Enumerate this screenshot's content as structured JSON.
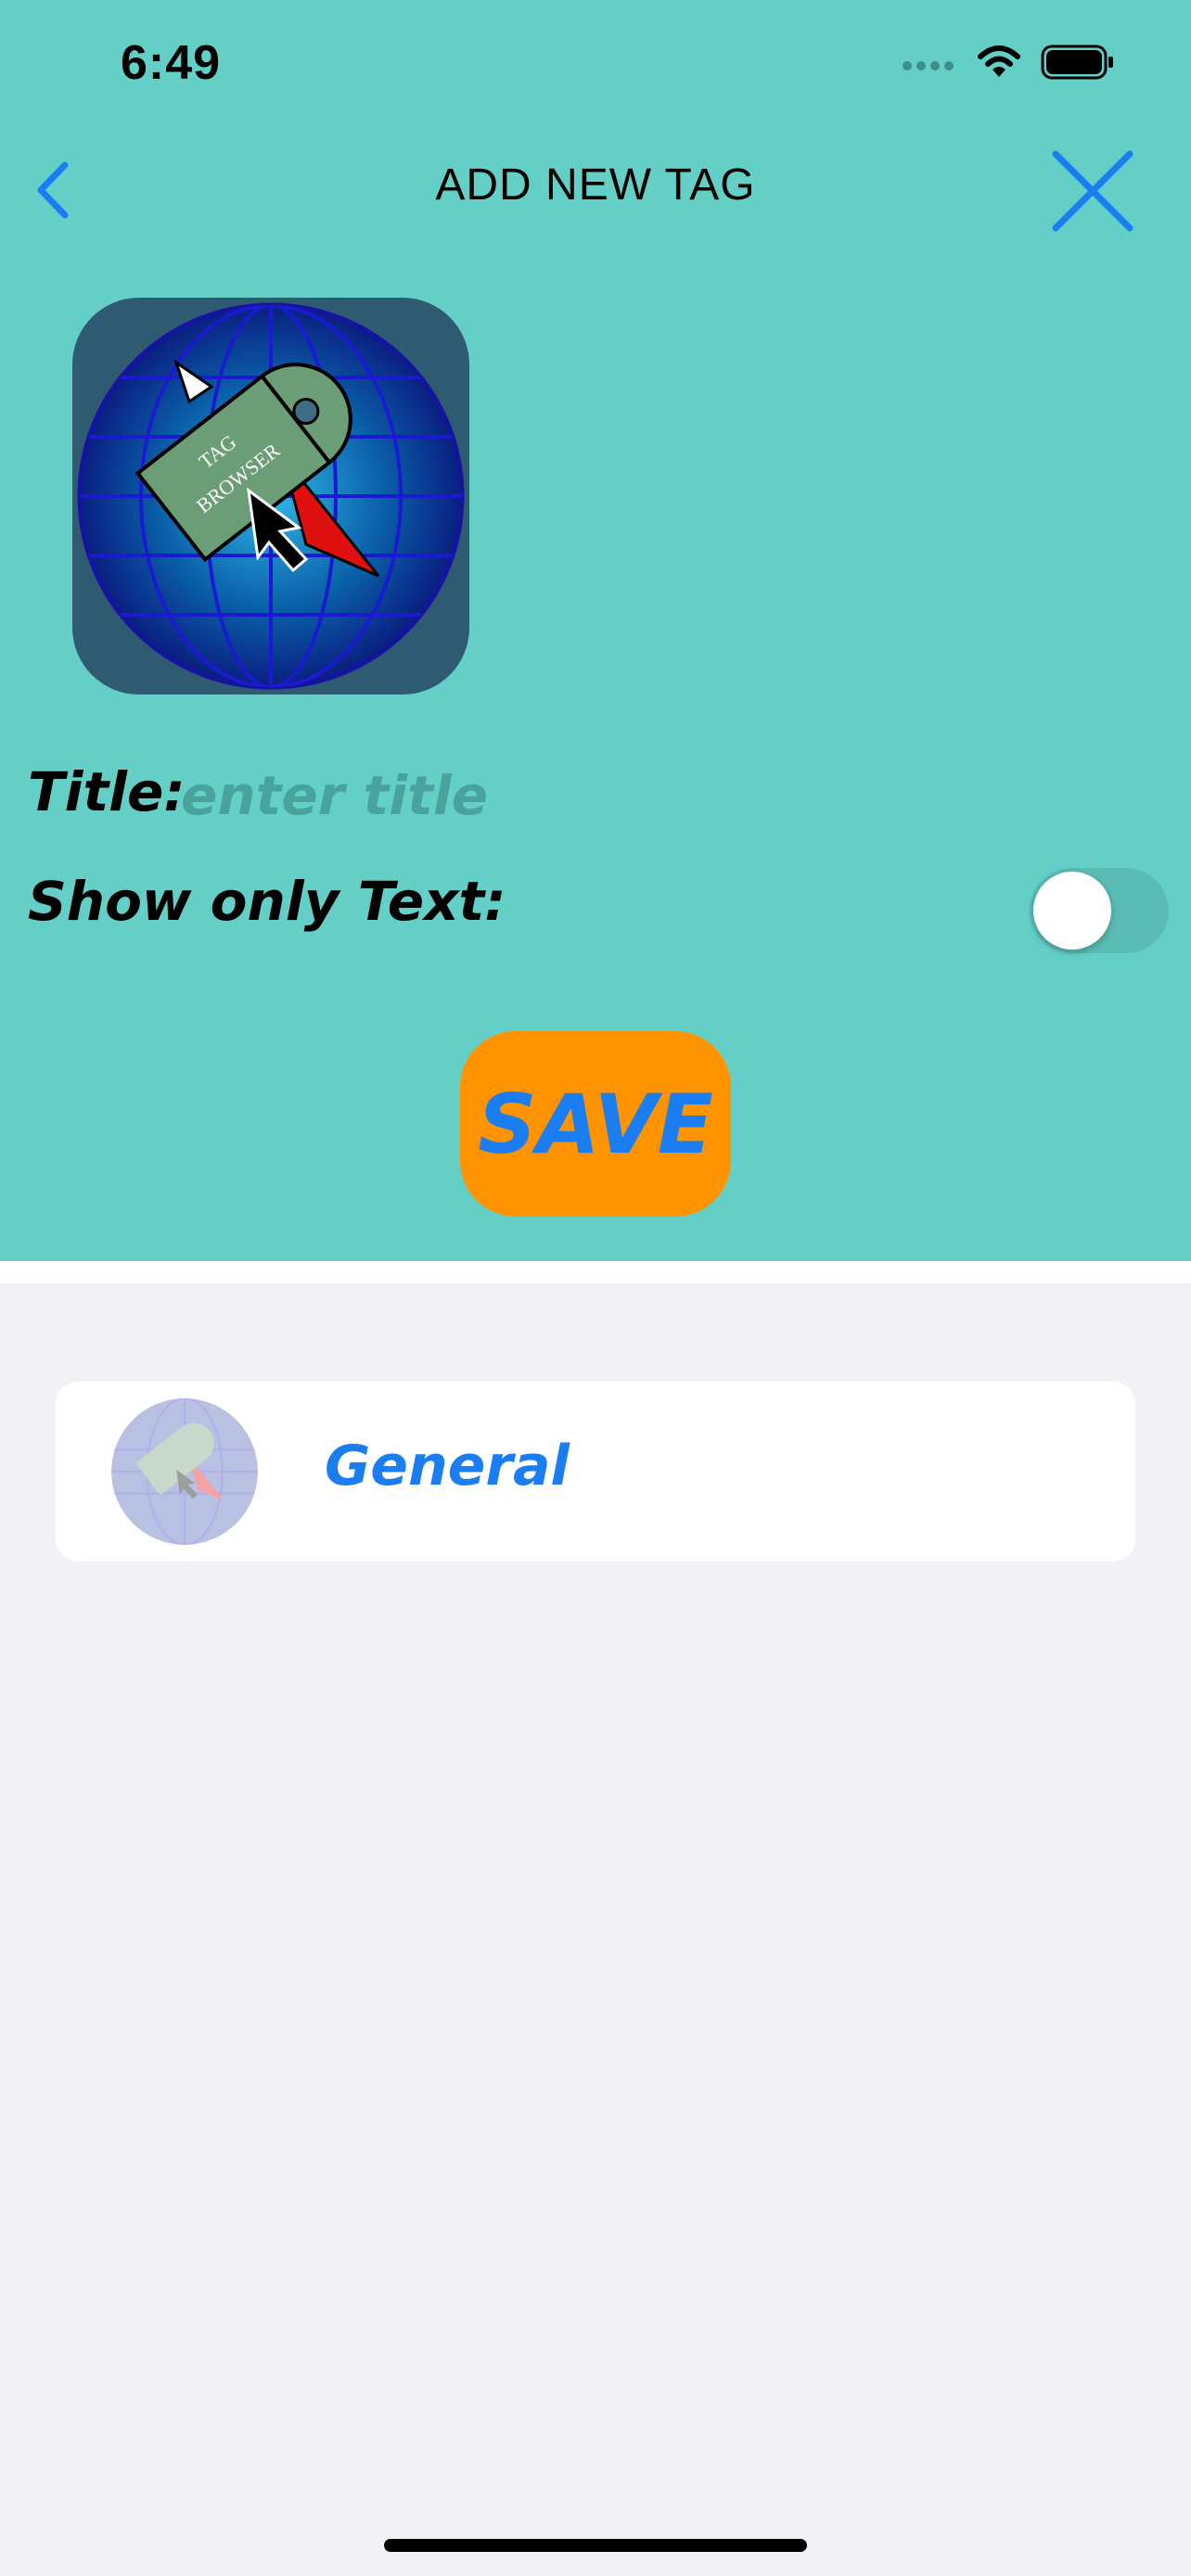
{
  "status_bar": {
    "time": "6:49",
    "icons": [
      "cellular-icon",
      "wifi-icon",
      "battery-icon"
    ]
  },
  "nav": {
    "title": "ADD NEW TAG",
    "back_icon": "chevron-left-icon",
    "close_icon": "close-icon"
  },
  "app_icon": {
    "lines": [
      "TAG",
      "BROWSER"
    ]
  },
  "form": {
    "title_label": "Title:",
    "title_value": "",
    "title_placeholder": "enter title",
    "show_only_text_label": "Show only Text:",
    "show_only_text_on": false
  },
  "save_button": {
    "label": "SAVE"
  },
  "tags": [
    {
      "name": "General",
      "icon": "tag-browser-icon"
    }
  ],
  "colors": {
    "header_background": "#64cfc7",
    "page_background": "#f1f1f6",
    "accent_blue": "#1b7df2",
    "save_orange": "#ff9400",
    "placeholder": "#48a39c"
  }
}
